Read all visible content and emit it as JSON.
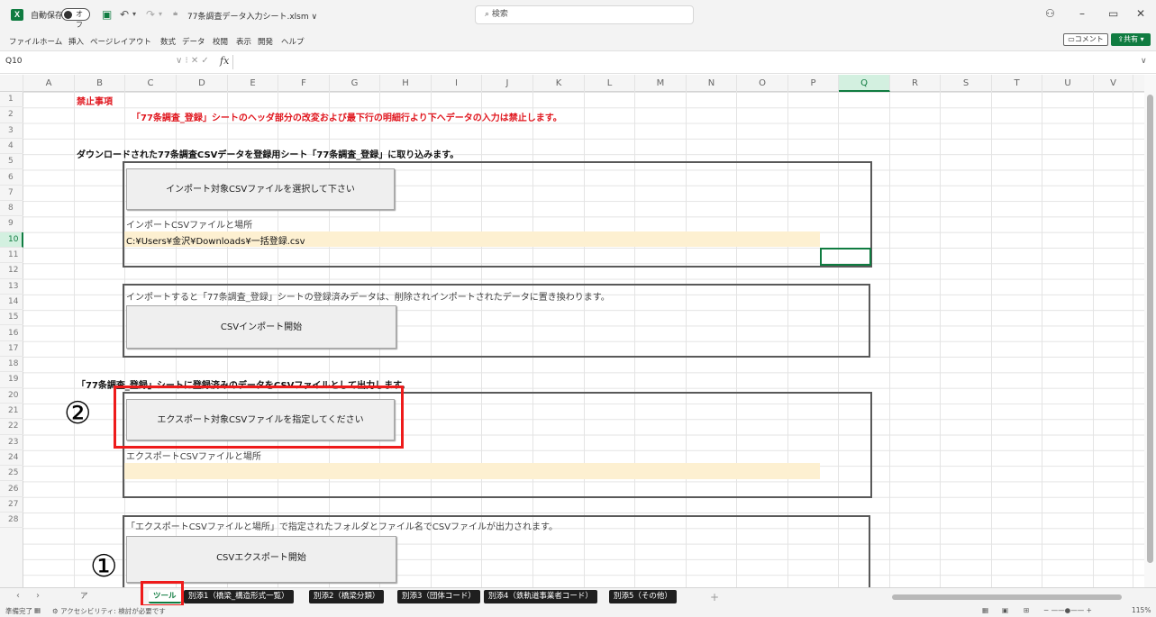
{
  "titlebar": {
    "app_icon": "X",
    "autosave_label": "自動保存",
    "autosave_state": "オフ",
    "filename": "77条調査データ入力シート.xlsm ∨",
    "search_placeholder": "検索"
  },
  "menu": [
    "ファイル",
    "ホーム",
    "挿入",
    "ページレイアウト",
    "数式",
    "データ",
    "校閲",
    "表示",
    "開発",
    "ヘルプ"
  ],
  "menu_right": {
    "comment": "コメント",
    "share": "共有"
  },
  "formula": {
    "namebox": "Q10",
    "fx": "fx",
    "value": ""
  },
  "columns": [
    "A",
    "B",
    "C",
    "D",
    "E",
    "F",
    "G",
    "H",
    "I",
    "J",
    "K",
    "L",
    "M",
    "N",
    "O",
    "P",
    "Q",
    "R",
    "S",
    "T",
    "U",
    "V"
  ],
  "active_column": "Q",
  "rows": [
    "1",
    "2",
    "3",
    "4",
    "5",
    "6",
    "7",
    "8",
    "9",
    "10",
    "11",
    "12",
    "13",
    "14",
    "15",
    "16",
    "17",
    "18",
    "19",
    "20",
    "21",
    "22",
    "23",
    "24",
    "25",
    "26",
    "27",
    "28"
  ],
  "active_row": "10",
  "sheet": {
    "prohibited_title": "禁止事項",
    "prohibited_text": "「77条調査_登録」シートのヘッダ部分の改変および最下行の明細行より下へデータの入力は禁止します。",
    "import_heading": "ダウンロードされた77条調査CSVデータを登録用シート「77条調査_登録」に取り込みます。",
    "import_select_button": "インポート対象CSVファイルを選択して下さい",
    "import_path_label": "インポートCSVファイルと場所",
    "import_path_value": "C:¥Users¥金沢¥Downloads¥一括登録.csv",
    "import_note": "インポートすると「77条調査_登録」シートの登録済みデータは、削除されインポートされたデータに置き換わります。",
    "import_start_button": "CSVインポート開始",
    "export_heading": "「77条調査_登録」シートに登録済みのデータをCSVファイルとして出力します。",
    "export_select_button": "エクスポート対象CSVファイルを指定してください",
    "export_path_label": "エクスポートCSVファイルと場所",
    "export_path_value": "",
    "export_note": "「エクスポートCSVファイルと場所」で指定されたフォルダとファイル名でCSVファイルが出力されます。",
    "export_start_button": "CSVエクスポート開始"
  },
  "annotations": {
    "marker_1": "①",
    "marker_2": "②"
  },
  "tabs": [
    {
      "label": "ア",
      "style": "light"
    },
    {
      "label": "ツール",
      "style": "active"
    },
    {
      "label": "別添1（橋梁_構造形式一覧）",
      "style": "dark"
    },
    {
      "label": "別添2（橋梁分類）",
      "style": "dark"
    },
    {
      "label": "別添3（団体コード）",
      "style": "dark"
    },
    {
      "label": "別添4（鉄軌道事業者コード）",
      "style": "dark"
    },
    {
      "label": "別添5（その他）",
      "style": "dark"
    }
  ],
  "status": {
    "ready": "準備完了",
    "accessibility": "アクセシビリティ: 検討が必要です",
    "zoom": "115%"
  },
  "colors": {
    "excel_green": "#107c41",
    "annotation_red": "#ee1b1b",
    "warning_red": "#e0161e",
    "highlight_yellow": "#fdf0d1"
  }
}
